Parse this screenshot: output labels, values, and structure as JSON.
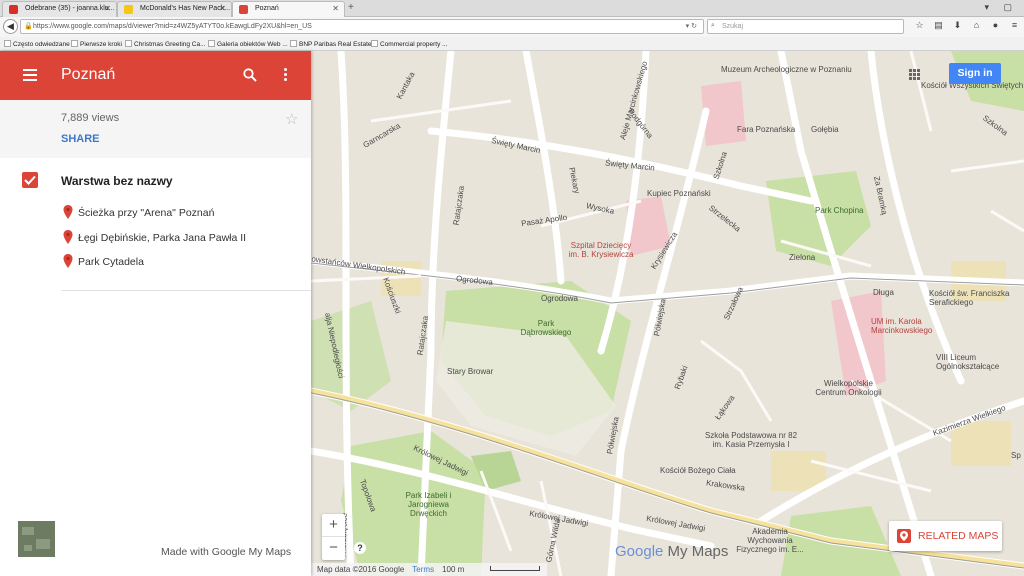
{
  "browser": {
    "tabs": [
      {
        "title": "Odebrane (35) - joanna.klu...",
        "favicon_color": "#d93025"
      },
      {
        "title": "McDonald's Has New Pack...",
        "favicon_color": "#f5c518"
      },
      {
        "title": "Poznań",
        "favicon_color": "#db4437"
      }
    ],
    "url": "https://www.google.com/maps/d/viewer?mid=z4WZ5yATYT0o.kEawgLdFy2XU&hl=en_US",
    "search_placeholder": "Szukaj",
    "bookmarks": [
      "Często odwiedzane",
      "Pierwsze kroki",
      "Christmas Greeting Ca...",
      "Galeria obiektów Web ...",
      "BNP Paribas Real Estate",
      "Commercial property ..."
    ]
  },
  "panel": {
    "title": "Poznań",
    "views": "7,889 views",
    "share_label": "SHARE",
    "layer_title": "Warstwa bez nazwy",
    "places": [
      "Ścieżka przy \"Arena\" Poznań",
      "Łęgi Dębińskie, Parka Jana Pawła II",
      "Park Cytadela"
    ],
    "made_with": "Made with Google My Maps",
    "accent_color": "#db4437"
  },
  "map": {
    "sign_in": "Sign in",
    "related_maps": "RELATED MAPS",
    "logo_google": "Google",
    "logo_mymaps": "My Maps",
    "footer": {
      "data": "Map data ©2016 Google",
      "terms": "Terms",
      "scale": "100 m"
    },
    "zoom_in": "+",
    "zoom_out": "−",
    "help": "?",
    "labels": {
      "muzeum": "Muzeum Archeologiczne w Poznaniu",
      "kosciol_wszystkich": "Kościół Wszystkich Świętych",
      "fara": "Fara Poznańska",
      "golebia": "Gołębia",
      "szkolna": "Szkolna",
      "za_bramka": "Za Bramką",
      "swiety_marcin_1": "Święty Marcin",
      "swiety_marcin_2": "Święty Marcin",
      "podgorna": "Podgórna",
      "kupiec": "Kupiec Poznański",
      "park_chopina": "Park Chopina",
      "pasaz_apollo": "Pasaż Apollo",
      "szpital": "Szpital Dziecięcy im. B. Krysiewicza",
      "krysiewicza": "Krysiewicza",
      "strzelecka": "Strzelecka",
      "zielona": "Zielona",
      "dluga": "Długa",
      "kosciol_franciszka": "Kościół św. Franciszka Serafickiego",
      "ogrodowa_1": "Ogrodowa",
      "ogrodowa_2": "Ogrodowa",
      "park_dabrowskiego": "Park Dąbrowskiego",
      "ratajczaka": "Ratajczaka",
      "kosciuszki": "Kościuszki",
      "um": "UM im. Karola Marcinkowskiego",
      "liceum": "VIII Liceum Ogólnokształcące",
      "stary_browar": "Stary Browar",
      "rybaki": "Rybaki",
      "lakowa": "Łąkowa",
      "wielkopolskie": "Wielkopolskie Centrum Onkologii",
      "kazimierza": "Kazimierza Wielkiego",
      "szkola": "Szkoła Podstawowa nr 82 im. Kasia Przemysła I",
      "kosciol_bozego": "Kościół Bożego Ciała",
      "krakowska": "Krakowska",
      "krolowej_1": "Królowej Jadwigi",
      "krolowej_2": "Królowej Jadwigi",
      "krolowej_3": "Królowej Jadwigi",
      "park_izabeli": "Park Izabeli i Jarogniewa Drwęckich",
      "akademia": "Akademia Wychowania Fizycznego im. E...",
      "topolowa": "Topolowa",
      "wierzbiecice": "Wierzbięcice",
      "garncarska": "Garncarska",
      "kantaka": "Kantaka",
      "wielkopolskich": "owstańców Wielkopolskich",
      "armii": "alja Niepodległości",
      "piekary": "Piekary",
      "wysoka": "Wysoka",
      "polwiejska": "Półwiejska",
      "strzalowa": "Strzałowa",
      "marcinkowskiego": "Aleje Marcinkowskiego",
      "gorna_wilda": "Górna Wilda",
      "szkolna_2": "Szkolna",
      "shop": "Sp"
    }
  }
}
